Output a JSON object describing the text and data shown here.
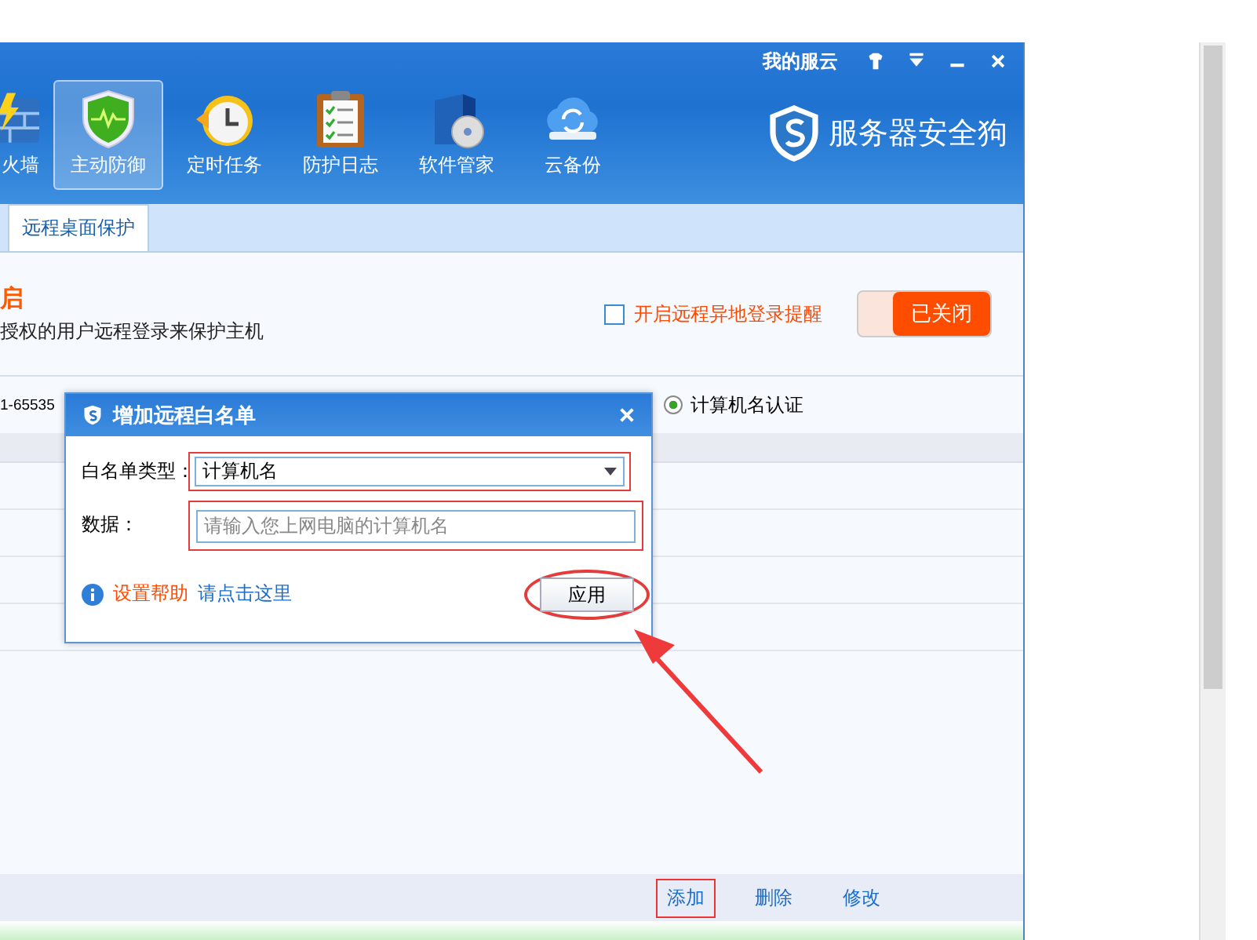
{
  "window": {
    "account": "我的服云",
    "logo_text": "服务器安全狗"
  },
  "toolbar": [
    {
      "kind": "firewall",
      "label": "火墙",
      "selected": false
    },
    {
      "kind": "shield",
      "label": "主动防御",
      "selected": true
    },
    {
      "kind": "clock",
      "label": "定时任务",
      "selected": false
    },
    {
      "kind": "clipboard",
      "label": "防护日志",
      "selected": false
    },
    {
      "kind": "software",
      "label": "软件管家",
      "selected": false
    },
    {
      "kind": "cloud",
      "label": "云备份",
      "selected": false
    }
  ],
  "tabs": [
    {
      "label": "远程桌面保护",
      "selected": true
    }
  ],
  "section": {
    "title": "启",
    "description": "授权的用户远程登录来保护主机",
    "alert_checkbox": {
      "label": "开启远程异地登录提醒",
      "checked": false
    },
    "toggle": {
      "label": "已关闭",
      "on": false
    }
  },
  "settings_row": {
    "port_text": "1-65535",
    "radio": {
      "label": "计算机名认证",
      "selected": true
    }
  },
  "dialog": {
    "title": "增加远程白名单",
    "type_label": "白名单类型：",
    "type_value": "计算机名",
    "type_highlighted": true,
    "data_label": "数据：",
    "data_placeholder": "请输入您上网电脑的计算机名",
    "data_highlighted": true,
    "help_label": "设置帮助",
    "help_link": "请点击这里",
    "apply_button": "应用",
    "apply_circled": true
  },
  "bottom_actions": [
    {
      "label": "添加",
      "highlighted": true
    },
    {
      "label": "删除",
      "highlighted": false
    },
    {
      "label": "修改",
      "highlighted": false
    }
  ]
}
